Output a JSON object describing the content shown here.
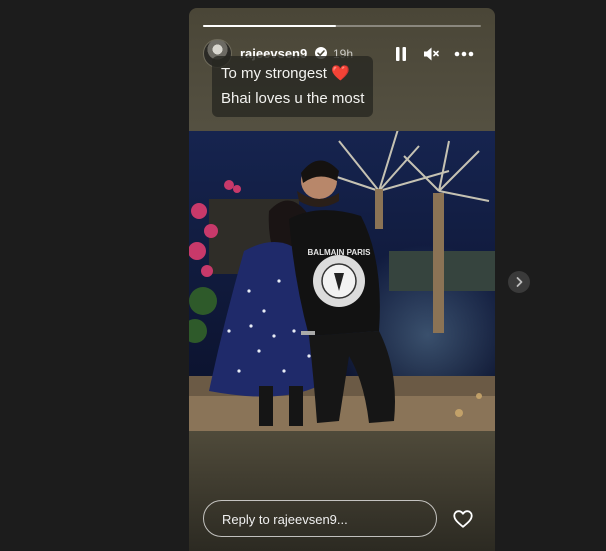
{
  "story": {
    "username": "rajeevsen9",
    "timestamp": "19h",
    "progress": 0.48,
    "caption_line1": "To my strongest",
    "caption_emoji": "❤️",
    "caption_line2": "Bhai loves u the most",
    "reply_placeholder": "Reply to rajeevsen9...",
    "sweater_text": "BALMAIN PARIS"
  },
  "icons": {
    "verified": "verified-badge-icon",
    "pause": "pause-icon",
    "mute": "volume-muted-icon",
    "more": "more-options-icon",
    "like": "heart-outline-icon",
    "next": "chevron-right-icon"
  },
  "colors": {
    "page_background": "#1c1c1c",
    "story_background": "#4f4a3a",
    "heart_emoji": "#e0313b"
  }
}
